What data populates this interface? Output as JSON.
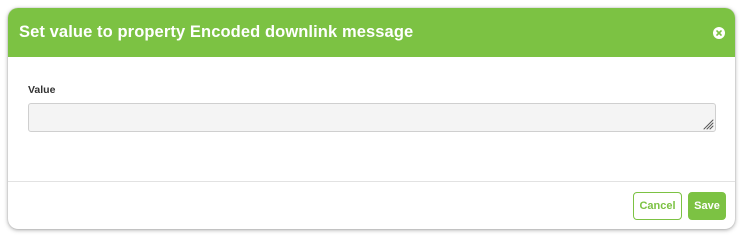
{
  "dialog": {
    "title": "Set value to property Encoded downlink message",
    "close_icon": "close-icon",
    "accent_color": "#7cc243"
  },
  "form": {
    "value_label": "Value",
    "value": "",
    "placeholder": ""
  },
  "footer": {
    "cancel_label": "Cancel",
    "save_label": "Save"
  }
}
